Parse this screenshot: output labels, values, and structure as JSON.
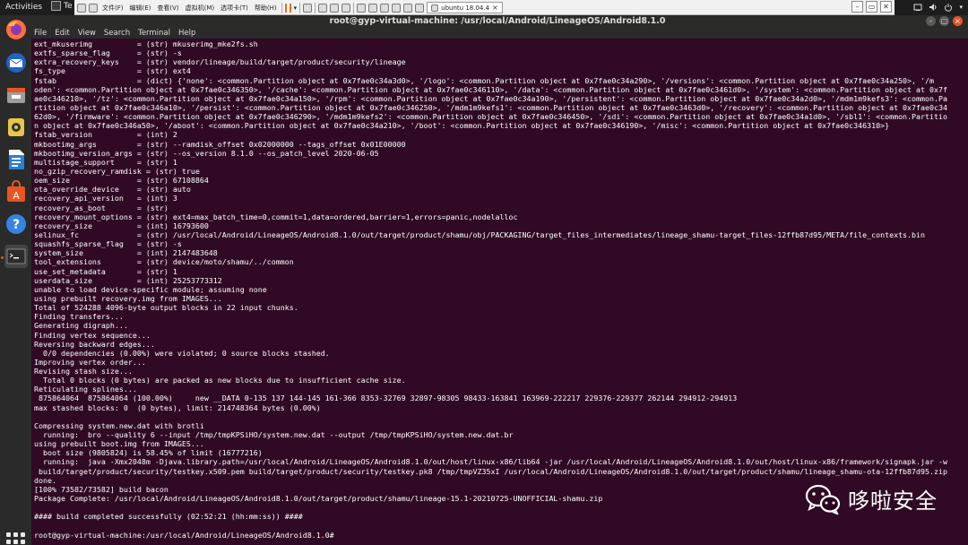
{
  "topbar": {
    "activities_label": "Activities",
    "app_menu_label": "Te"
  },
  "vmware": {
    "menus": [
      "文件(F)",
      "编辑(E)",
      "查看(V)",
      "虚拟机(M)",
      "选项卡(T)",
      "帮助(H)"
    ],
    "tab_label": "ubuntu 18.04.4",
    "tab_close": "×",
    "win_min": "–",
    "win_restore": "▭",
    "win_close": "✕"
  },
  "window": {
    "title": "root@gyp-virtual-machine: /usr/local/Android/LineageOS/Android8.1.0",
    "minimize": "–",
    "maximize": "▢",
    "close": "×"
  },
  "menubar": {
    "items": [
      "File",
      "Edit",
      "View",
      "Search",
      "Terminal",
      "Help"
    ]
  },
  "terminal": {
    "lines": [
      "ext_mkuserimg          = (str) mkuserimg_mke2fs.sh",
      "extfs_sparse_flag      = (str) -s",
      "extra_recovery_keys    = (str) vendor/lineage/build/target/product/security/lineage",
      "fs_type                = (str) ext4",
      "fstab                  = (dict) {'none': <common.Partition object at 0x7fae0c34a3d0>, '/logo': <common.Partition object at 0x7fae0c34a290>, '/versions': <common.Partition object at 0x7fae0c34a250>, '/m",
      "oden': <common.Partition object at 0x7fae0c346350>, '/cache': <common.Partition object at 0x7fae0c346110>, '/data': <common.Partition object at 0x7fae0c3461d0>, '/system': <common.Partition object at 0x7f",
      "ae0c346210>, '/tz': <common.Partition object at 0x7fae0c34a150>, '/rpm': <common.Partition object at 0x7fae0c34a190>, '/persistent': <common.Partition object at 0x7fae0c34a2d0>, '/mdm1m9kefs3': <common.Pa",
      "rtition object at 0x7fae0c346a10>, '/persist': <common.Partition object at 0x7fae0c346250>, '/mdm1m9kefs1': <common.Partition object at 0x7fae0c3463d0>, '/recovery': <common.Partition object at 0x7fae0c34",
      "62d0>, '/firmware': <common.Partition object at 0x7fae0c346290>, '/mdm1m9kefs2': <common.Partition object at 0x7fae0c346450>, '/sdi': <common.Partition object at 0x7fae0c34a1d0>, '/sbl1': <common.Partitio",
      "n object at 0x7fae0c346a50>, '/aboot': <common.Partition object at 0x7fae0c34a210>, '/boot': <common.Partition object at 0x7fae0c346190>, '/misc': <common.Partition object at 0x7fae0c346310>}",
      "fstab_version          = (int) 2",
      "mkbootimg_args         = (str) --ramdisk_offset 0x02000000 --tags_offset 0x01E00000",
      "mkbootimg_version_args = (str) --os_version 8.1.0 --os_patch_level 2020-06-05",
      "multistage_support     = (str) 1",
      "no_gzip_recovery_ramdisk = (str) true",
      "oem_size               = (str) 67108864",
      "ota_override_device    = (str) auto",
      "recovery_api_version   = (int) 3",
      "recovery_as_boot       = (str)",
      "recovery_mount_options = (str) ext4=max_batch_time=0,commit=1,data=ordered,barrier=1,errors=panic,nodelalloc",
      "recovery_size          = (int) 16793600",
      "selinux_fc             = (str) /usr/local/Android/LineageOS/Android8.1.0/out/target/product/shamu/obj/PACKAGING/target_files_intermediates/lineage_shamu-target_files-12ffb87d95/META/file_contexts.bin",
      "squashfs_sparse_flag   = (str) -s",
      "system_size            = (int) 2147483648",
      "tool_extensions        = (str) device/moto/shamu/../common",
      "use_set_metadata       = (str) 1",
      "userdata_size          = (int) 25253773312",
      "unable to load device-specific module; assuming none",
      "using prebuilt recovery.img from IMAGES...",
      "Total of 524288 4096-byte output blocks in 22 input chunks.",
      "Finding transfers...",
      "Generating digraph...",
      "Finding vertex sequence...",
      "Reversing backward edges...",
      "  0/0 dependencies (0.00%) were violated; 0 source blocks stashed.",
      "Improving vertex order...",
      "Revising stash size...",
      "  Total 0 blocks (0 bytes) are packed as new blocks due to insufficient cache size.",
      "Reticulating splines...",
      " 875864064  875864064 (100.00%)     new __DATA 0-135 137 144-145 161-366 8353-32769 32897-98305 98433-163841 163969-222217 229376-229377 262144 294912-294913",
      "max stashed blocks: 0  (0 bytes), limit: 214748364 bytes (0.00%)",
      "",
      "Compressing system.new.dat with brotli",
      "  running:  bro --quality 6 --input /tmp/tmpKPSiHO/system.new.dat --output /tmp/tmpKPSiHO/system.new.dat.br",
      "using prebuilt boot.img from IMAGES...",
      "  boot size (9805824) is 58.45% of limit (16777216)",
      "  running:  java -Xmx2048m -Djava.library.path=/usr/local/Android/LineageOS/Android8.1.0/out/host/linux-x86/lib64 -jar /usr/local/Android/LineageOS/Android8.1.0/out/host/linux-x86/framework/signapk.jar -w",
      " build/target/product/security/testkey.x509.pem build/target/product/security/testkey.pk8 /tmp/tmpVZ35xI /usr/local/Android/LineageOS/Android8.1.0/out/target/product/shamu/lineage_shamu-ota-12ffb87d95.zip",
      "done.",
      "[100% 73582/73582] build bacon",
      "Package Complete: /usr/local/Android/LineageOS/Android8.1.0/out/target/product/shamu/lineage-15.1-20210725-UNOFFICIAL-shamu.zip",
      "",
      "#### build completed successfully (02:52:21 (hh:mm:ss)) ####",
      "",
      "root@gyp-virtual-machine:/usr/local/Android/LineageOS/Android8.1.0#"
    ],
    "green_line_index": 53
  },
  "watermark": {
    "text": "哆啦安全"
  },
  "colors": {
    "terminal_bg": "#300a24",
    "success_green": "#4e9a06",
    "ubuntu_orange": "#e95420"
  }
}
